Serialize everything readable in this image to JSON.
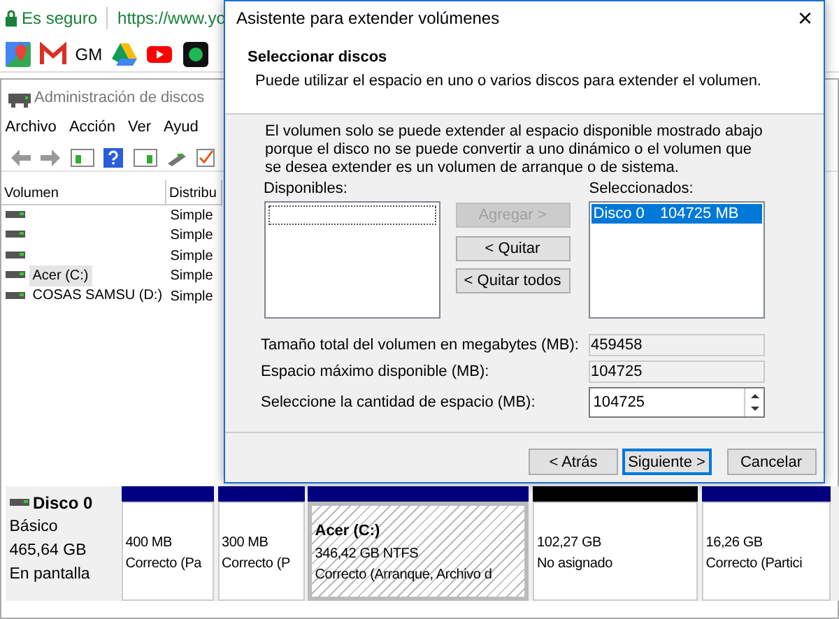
{
  "browser": {
    "security": "Es seguro",
    "url": "https://www.yo",
    "bookmarks": [
      {
        "kind": "maps"
      },
      {
        "kind": "gmail"
      },
      {
        "kind": "text",
        "label": "GM"
      },
      {
        "kind": "drive"
      },
      {
        "kind": "youtube"
      },
      {
        "kind": "dot"
      }
    ]
  },
  "disk_manager": {
    "title": "Administración de discos",
    "menu": [
      "Archivo",
      "Acción",
      "Ver",
      "Ayud"
    ],
    "columns": [
      "Volumen",
      "Distribu"
    ],
    "rows": [
      {
        "volume": "",
        "layout": "Simple",
        "selected": false
      },
      {
        "volume": "",
        "layout": "Simple",
        "selected": false
      },
      {
        "volume": "",
        "layout": "Simple",
        "selected": false
      },
      {
        "volume": "Acer (C:)",
        "layout": "Simple",
        "selected": true
      },
      {
        "volume": "COSAS SAMSU (D:)",
        "layout": "Simple",
        "selected": false
      }
    ],
    "disk": {
      "name": "Disco 0",
      "type": "Básico",
      "size": "465,64 GB",
      "status": "En pantalla",
      "partitions": [
        {
          "kind": "primary",
          "selected": false,
          "lines": [
            "400 MB",
            "Correcto (Pa"
          ]
        },
        {
          "kind": "primary",
          "selected": false,
          "lines": [
            "300 MB",
            "Correcto (P"
          ]
        },
        {
          "kind": "primary",
          "selected": true,
          "label": "Acer  (C:)",
          "lines": [
            "346,42 GB NTFS",
            "Correcto (Arranque, Archivo d"
          ]
        },
        {
          "kind": "unallocated",
          "selected": false,
          "lines": [
            "102,27 GB",
            "No asignado"
          ]
        },
        {
          "kind": "primary",
          "selected": false,
          "lines": [
            "16,26 GB",
            "Correcto (Partici"
          ]
        }
      ]
    }
  },
  "dialog": {
    "title": "Asistente para extender volúmenes",
    "close": "×",
    "heading": "Seleccionar discos",
    "subheading": "Puede utilizar el espacio en uno o varios discos para extender el volumen.",
    "note": "El volumen solo se puede extender al espacio disponible mostrado abajo porque el disco no se puede convertir a uno dinámico o el volumen que se desea extender es un volumen de arranque o de sistema.",
    "available_label": "Disponibles:",
    "selected_label": "Seleccionados:",
    "move_buttons": [
      {
        "label": "Agregar >",
        "disabled": true
      },
      {
        "label": "< Quitar",
        "disabled": false
      },
      {
        "label": "< Quitar todos",
        "disabled": false
      }
    ],
    "selected_items": [
      {
        "disk": "Disco 0",
        "size": "104725 MB",
        "selected": true
      }
    ],
    "fields": [
      {
        "kind": "readonly",
        "label": "Tamaño total del volumen en megabytes (MB):",
        "value": "459458"
      },
      {
        "kind": "readonly",
        "label": "Espacio máximo disponible (MB):",
        "value": "104725"
      },
      {
        "kind": "spinner",
        "label": "Seleccione la cantidad de espacio (MB):",
        "value": "104725"
      }
    ],
    "buttons": [
      {
        "label": "< Atrás",
        "default": false
      },
      {
        "label": "Siguiente >",
        "default": true
      },
      {
        "label": "Cancelar",
        "default": false
      }
    ]
  }
}
